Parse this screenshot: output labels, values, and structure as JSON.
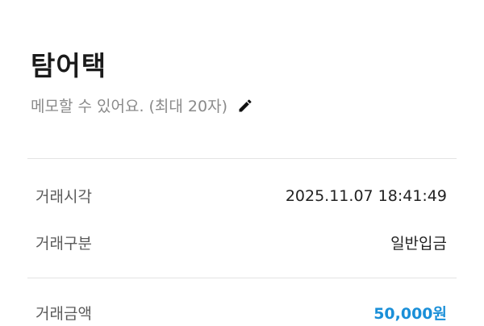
{
  "header": {
    "title": "탐어택",
    "memo_placeholder": "메모할 수 있어요. (최대 20자)",
    "edit_icon": "pencil-icon"
  },
  "details": {
    "rows": [
      {
        "label": "거래시각",
        "value": "2025.11.07 18:41:49"
      },
      {
        "label": "거래구분",
        "value": "일반입금"
      }
    ],
    "amount": {
      "label": "거래금액",
      "value": "50,000원"
    }
  },
  "colors": {
    "amount": "#1a8fd8",
    "label": "#5b5b5b",
    "memo": "#8a8a8a",
    "divider": "#e4e4e4"
  }
}
